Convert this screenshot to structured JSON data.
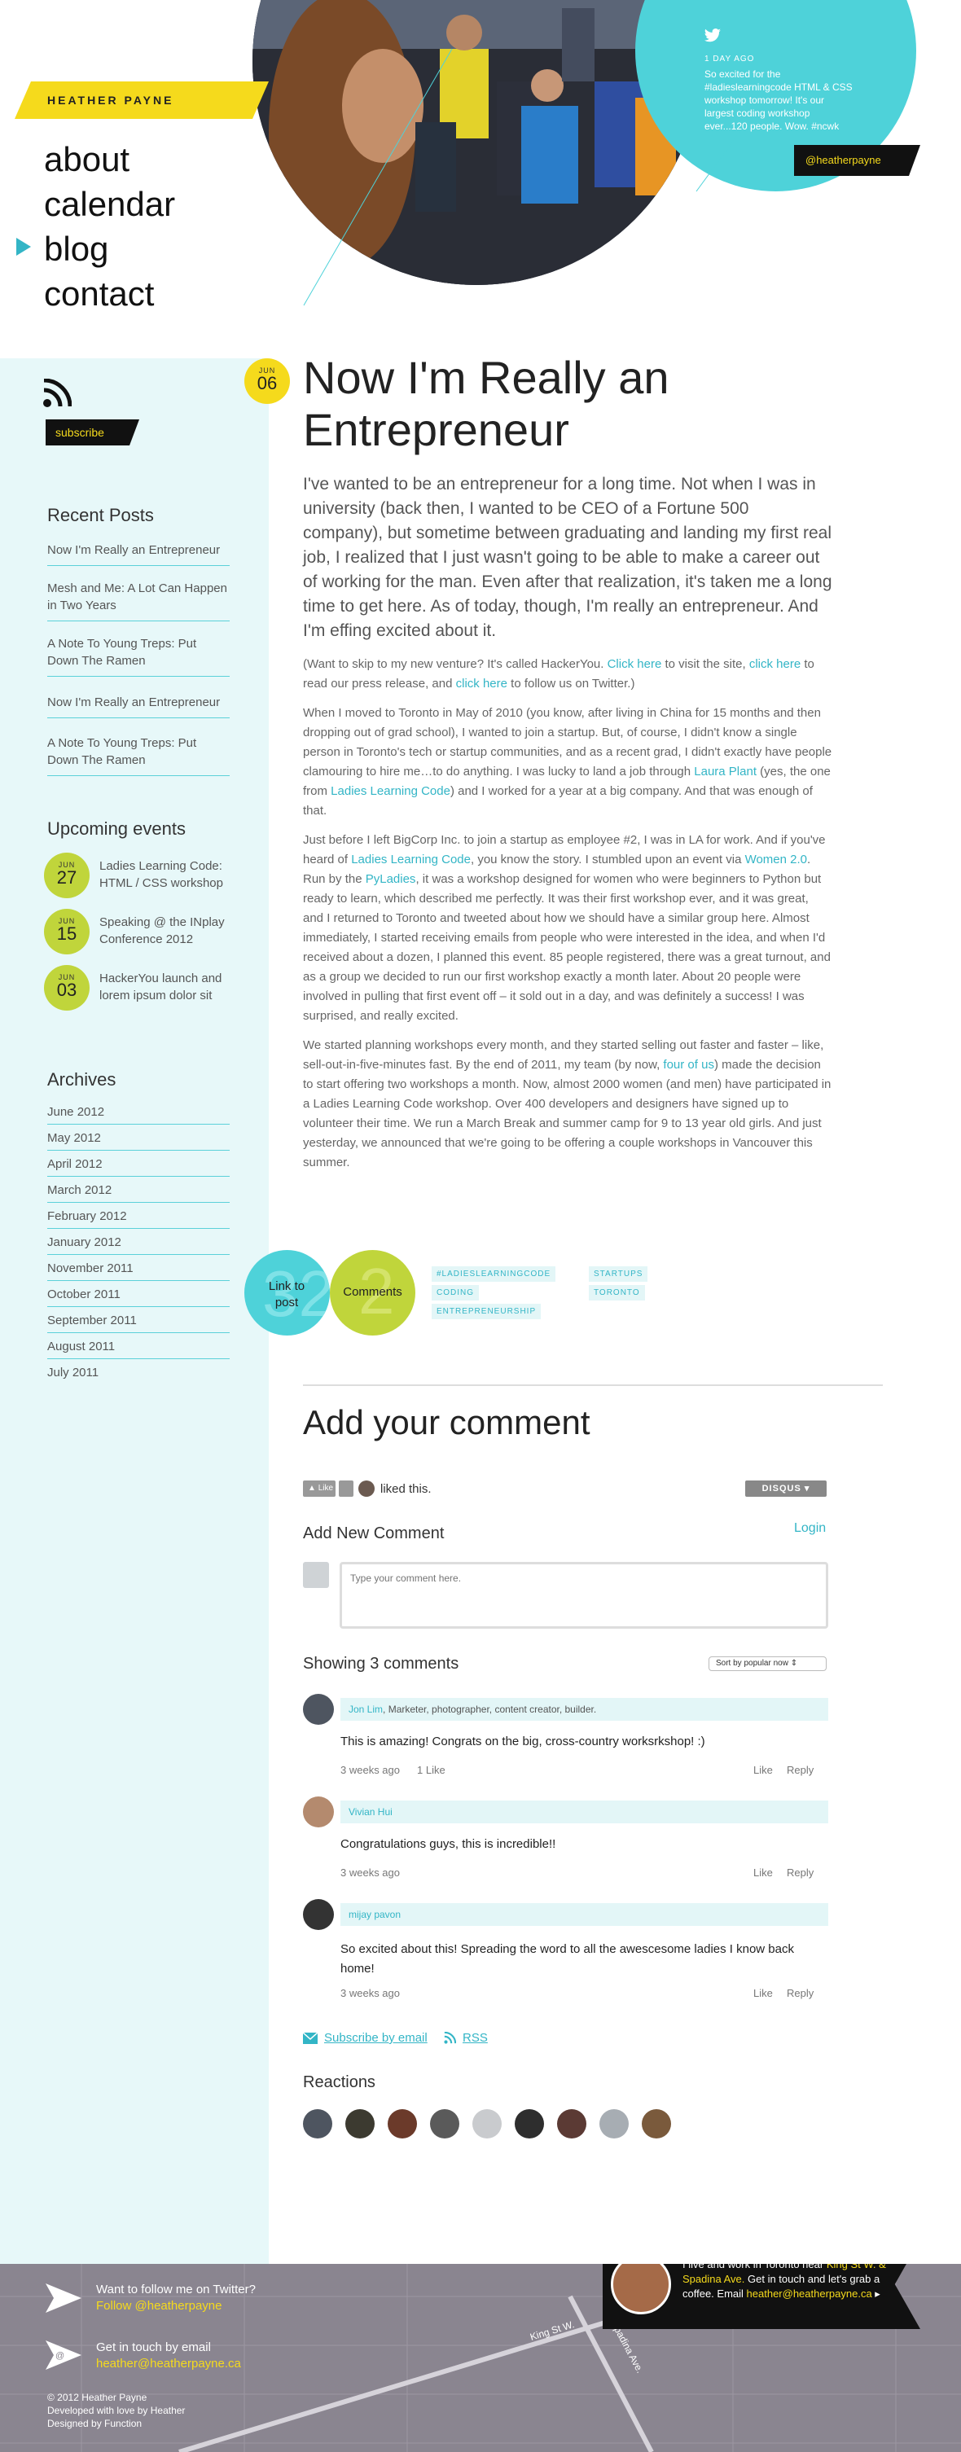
{
  "site": {
    "name": "HEATHER PAYNE"
  },
  "nav": [
    {
      "label": "about"
    },
    {
      "label": "calendar"
    },
    {
      "label": "blog"
    },
    {
      "label": "contact"
    }
  ],
  "tweet": {
    "time": "1 DAY AGO",
    "text": "So excited for the #ladieslearningcode HTML & CSS workshop tomorrow! It's our largest coding workshop ever...120 people. Wow. #ncwk",
    "handle": "@heatherpayne"
  },
  "sidebar": {
    "subscribe": "subscribe",
    "recent_title": "Recent Posts",
    "recent": [
      "Now I'm Really an Entrepreneur",
      "Mesh and Me: A Lot Can Happen in Two Years",
      "A Note To Young Treps: Put Down The Ramen",
      "Now I'm Really an Entrepreneur",
      "A Note To Young Treps: Put Down The Ramen"
    ],
    "events_title": "Upcoming events",
    "events": [
      {
        "month": "JUN",
        "day": "27",
        "title": "Ladies Learning Code: HTML / CSS workshop"
      },
      {
        "month": "JUN",
        "day": "15",
        "title": "Speaking @ the INplay Conference 2012"
      },
      {
        "month": "JUN",
        "day": "03",
        "title": "HackerYou launch and lorem ipsum dolor sit"
      }
    ],
    "archives_title": "Archives",
    "archives": [
      "June 2012",
      "May 2012",
      "April 2012",
      "March 2012",
      "February 2012",
      "January 2012",
      "November 2011",
      "October 2011",
      "September 2011",
      "August 2011",
      "July 2011"
    ]
  },
  "post": {
    "month": "JUN",
    "day": "06",
    "title": "Now I'm Really an Entrepreneur",
    "lead": "I've wanted to be an entrepreneur for a long time. Not when I was in university (back then, I wanted to be CEO of a Fortune 500 company), but sometime between graduating and landing my first real job, I realized that I just wasn't going to be able to make a career out of working for the man. Even after that realization, it's taken me a long time to get here. As of today, though, I'm really an entrepreneur. And I'm effing excited about it.",
    "p1": {
      "a": "(Want to skip to my new venture? It's called HackerYou. ",
      "l1": "Click here",
      "b": " to visit the site, ",
      "l2": "click here",
      "c": " to read our press release, and ",
      "l3": "click here",
      "d": " to follow us on Twitter.)"
    },
    "p2": {
      "a": "When I moved to Toronto in May of 2010 (you know, after living in China for 15 months and then dropping out of grad school), I wanted to join a startup. But, of course, I didn't know a single person in Toronto's tech or startup communities, and as a recent grad, I didn't exactly have people clamouring to hire me…to do anything. I was lucky to land a job through ",
      "l1": "Laura Plant",
      "b": " (yes, the one from ",
      "l2": "Ladies Learning Code",
      "c": ") and I worked for a year at a big company. And that was enough of that."
    },
    "p3": {
      "a": "Just before I left BigCorp Inc. to join a startup as employee #2, I was in LA for work. And if you've heard of ",
      "l1": "Ladies Learning Code",
      "b": ", you know the story. I stumbled upon an event via ",
      "l2": "Women 2.0",
      "c": ". Run by the ",
      "l3": "PyLadies",
      "d": ", it was a workshop designed for women who were beginners to Python but ready to learn, which described me perfectly. It was their first workshop ever, and it was great, and I returned to Toronto and tweeted about how we should have a similar group here. Almost immediately, I started receiving emails from people who were interested in the idea, and when I'd received about a dozen, I planned this event. 85 people registered, there was a great turnout, and as a group we decided to run our first workshop exactly a month later. About 20 people were involved in pulling that first event off – it sold out in a day, and was definitely a success! I was surprised, and really excited."
    },
    "p4": {
      "a": "We started planning workshops every month, and they started selling out faster and faster – like, sell-out-in-five-minutes fast. By the end of 2011, my team (by now, ",
      "l1": "four of us",
      "b": ") made the decision to start offering two workshops a month. Now, almost 2000 women (and men) have participated in a Ladies Learning Code workshop. Over 400 developers and designers have signed up to volunteer their time. We run a March Break and summer camp for 9 to 13 year old girls. And just yesterday, we announced that we're going to be offering a couple workshops in Vancouver this summer."
    },
    "link_label": "Link to post",
    "link_num": "32",
    "comments_label": "Comments",
    "comments_num": "2",
    "tags": [
      "#LADIESLEARNINGCODE",
      "CODING",
      "ENTREPRENEURSHIP",
      "STARTUPS",
      "TORONTO"
    ]
  },
  "comments": {
    "title": "Add your comment",
    "like_btn": "Like",
    "liked_text": "liked this.",
    "disqus": "DISQUS",
    "add_new": "Add New Comment",
    "login": "Login",
    "placeholder": "Type your comment here.",
    "showing": "Showing 3 comments",
    "sort": "Sort by popular now",
    "items": [
      {
        "name": "Jon Lim",
        "bio": ", Marketer, photographer, content creator, builder.",
        "text": "This is amazing! Congrats on the big, cross-country worksrkshop! :)",
        "time": "3 weeks ago",
        "likes": "1 Like",
        "like": "Like",
        "reply": "Reply"
      },
      {
        "name": "Vivian Hui",
        "bio": "",
        "text": "Congratulations guys, this is incredible!!",
        "time": "3 weeks ago",
        "likes": "",
        "like": "Like",
        "reply": "Reply"
      },
      {
        "name": "mijay pavon",
        "bio": "",
        "text": "So excited about this! Spreading the word to all the awescesome ladies I know back home!",
        "time": "3 weeks ago",
        "likes": "",
        "like": "Like",
        "reply": "Reply"
      }
    ],
    "subscribe_email": "Subscribe by email",
    "rss": "RSS",
    "reactions_title": "Reactions"
  },
  "footer": {
    "twitter_text": "Want to follow me on Twitter?",
    "twitter_link": "Follow @heatherpayne",
    "email_text": "Get in touch by email",
    "email_link": "heather@heatherpayne.ca",
    "copyright": "© 2012 Heather Payne",
    "developed": "Developed with love by Heather",
    "designed": "Designed by Function",
    "location_a": "I live and work in Toronto near ",
    "location_link": "King St W. & Spadina Ave.",
    "location_b": " Get in touch and let's grab a coffee. Email ",
    "location_email": "heather@heatherpayne.ca",
    "street1": "King St W.",
    "street2": "Spadina Ave."
  }
}
